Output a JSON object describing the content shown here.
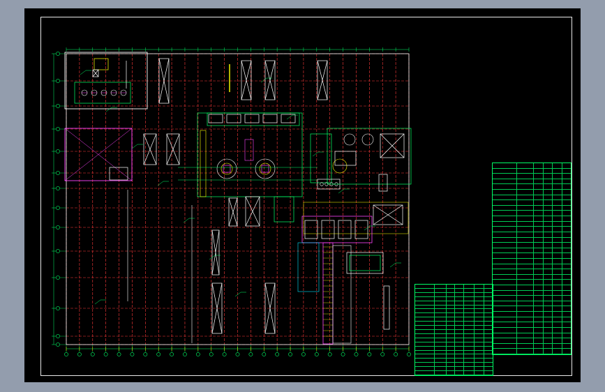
{
  "drawing": {
    "title": "",
    "background": "#000000",
    "surround": "#939dad",
    "line_colors": {
      "axis": "#ff3b3b",
      "equipment": "#00ff66",
      "detail": "#ffffff",
      "accent": "#ff44ff",
      "highlight": "#ffff00",
      "cyan": "#00e5ff"
    }
  },
  "notes": {
    "heading": "",
    "lines": []
  },
  "equipment_list": {
    "rows": 36,
    "columns": 6
  },
  "title_block": {
    "rows": 22,
    "columns": 7
  }
}
